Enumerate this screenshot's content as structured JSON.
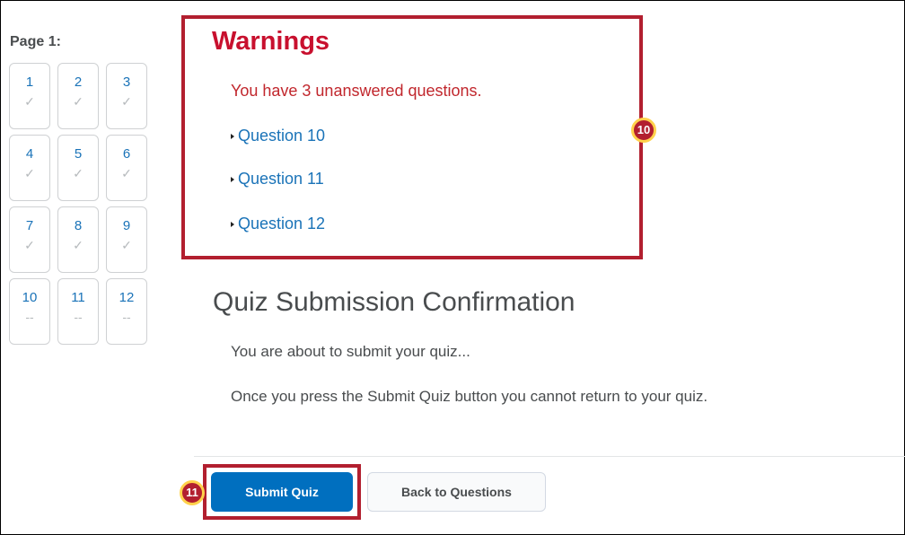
{
  "sidebar": {
    "page_label": "Page 1:",
    "questions": [
      {
        "num": "1",
        "status": "✓"
      },
      {
        "num": "2",
        "status": "✓"
      },
      {
        "num": "3",
        "status": "✓"
      },
      {
        "num": "4",
        "status": "✓"
      },
      {
        "num": "5",
        "status": "✓"
      },
      {
        "num": "6",
        "status": "✓"
      },
      {
        "num": "7",
        "status": "✓"
      },
      {
        "num": "8",
        "status": "✓"
      },
      {
        "num": "9",
        "status": "✓"
      },
      {
        "num": "10",
        "status": "--"
      },
      {
        "num": "11",
        "status": "--"
      },
      {
        "num": "12",
        "status": "--"
      }
    ]
  },
  "warnings": {
    "title": "Warnings",
    "message": "You have 3 unanswered questions.",
    "links": [
      "Question 10",
      "Question 11",
      "Question 12"
    ]
  },
  "callouts": {
    "warnings": "10",
    "submit": "11"
  },
  "confirmation": {
    "title": "Quiz Submission Confirmation",
    "line1": "You are about to submit your quiz...",
    "line2": "Once you press the Submit Quiz button you cannot return to your quiz."
  },
  "buttons": {
    "submit": "Submit Quiz",
    "back": "Back to Questions"
  },
  "colors": {
    "link": "#1a73b8",
    "warning": "#c8102e",
    "primary": "#006fbf",
    "highlight": "#b21f2f"
  }
}
